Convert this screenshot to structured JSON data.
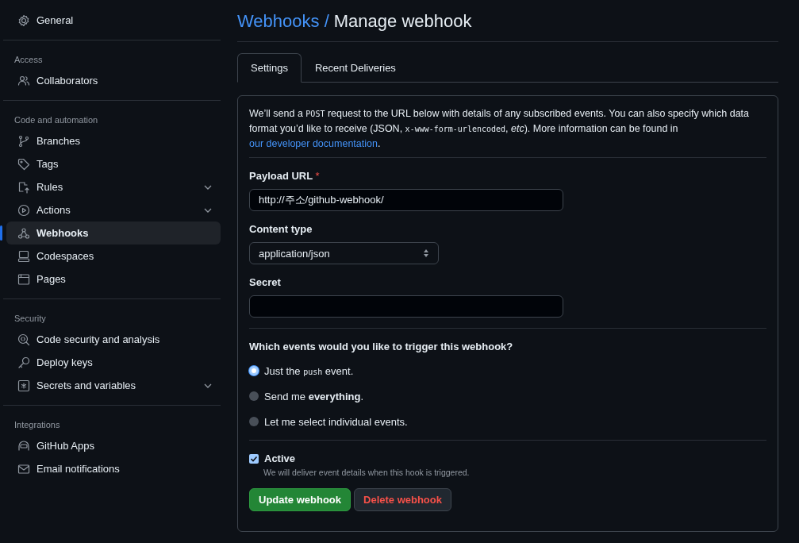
{
  "sidebar": {
    "sections": [
      {
        "items": [
          {
            "label": "General",
            "selected": false,
            "expandable": false
          }
        ]
      },
      {
        "heading": "Access",
        "items": [
          {
            "label": "Collaborators",
            "selected": false,
            "expandable": false
          }
        ]
      },
      {
        "heading": "Code and automation",
        "items": [
          {
            "label": "Branches",
            "selected": false,
            "expandable": false
          },
          {
            "label": "Tags",
            "selected": false,
            "expandable": false
          },
          {
            "label": "Rules",
            "selected": false,
            "expandable": true
          },
          {
            "label": "Actions",
            "selected": false,
            "expandable": true
          },
          {
            "label": "Webhooks",
            "selected": true,
            "expandable": false
          },
          {
            "label": "Codespaces",
            "selected": false,
            "expandable": false
          },
          {
            "label": "Pages",
            "selected": false,
            "expandable": false
          }
        ]
      },
      {
        "heading": "Security",
        "items": [
          {
            "label": "Code security and analysis",
            "selected": false,
            "expandable": false
          },
          {
            "label": "Deploy keys",
            "selected": false,
            "expandable": false
          },
          {
            "label": "Secrets and variables",
            "selected": false,
            "expandable": true
          }
        ]
      },
      {
        "heading": "Integrations",
        "items": [
          {
            "label": "GitHub Apps",
            "selected": false,
            "expandable": false
          },
          {
            "label": "Email notifications",
            "selected": false,
            "expandable": false
          }
        ]
      }
    ]
  },
  "header": {
    "breadcrumb": "Webhooks /",
    "title": "Manage webhook"
  },
  "tabs": [
    {
      "label": "Settings",
      "selected": true
    },
    {
      "label": "Recent Deliveries",
      "selected": false
    }
  ],
  "form": {
    "intro": [
      {
        "kind": "text",
        "text": "We’ll send a "
      },
      {
        "kind": "code",
        "text": "POST"
      },
      {
        "kind": "text",
        "text": " request to the URL below with details of any subscribed events. You can also specify which data format you’d like to receive (JSON, "
      },
      {
        "kind": "code",
        "text": "x-www-form-urlencoded"
      },
      {
        "kind": "text",
        "text": ", *etc*). More information can be found in "
      },
      {
        "kind": "link",
        "text": "our developer documentation"
      },
      {
        "kind": "text",
        "text": "."
      }
    ],
    "payload_url": {
      "label": "Payload URL",
      "required_mark": "*",
      "value": "http://주소/github-webhook/"
    },
    "content_type": {
      "label": "Content type",
      "value": "application/json"
    },
    "secret": {
      "label": "Secret"
    },
    "events": {
      "question": "Which events would you like to trigger this webhook?",
      "options": [
        {
          "selected": true,
          "parts": [
            {
              "kind": "text",
              "text": "Just the "
            },
            {
              "kind": "code",
              "text": "push"
            },
            {
              "kind": "text",
              "text": " event."
            }
          ]
        },
        {
          "selected": false,
          "parts": [
            {
              "kind": "text",
              "text": "Send me **everything**."
            }
          ]
        },
        {
          "selected": false,
          "parts": [
            {
              "kind": "text",
              "text": "Let me select individual events."
            }
          ]
        }
      ]
    },
    "active": {
      "label": "Active",
      "checked": true,
      "hint": "We will deliver event details when this hook is triggered."
    },
    "buttons": [
      {
        "label": "Update webhook",
        "kind": "primary"
      },
      {
        "label": "Delete webhook",
        "kind": "danger"
      }
    ]
  }
}
